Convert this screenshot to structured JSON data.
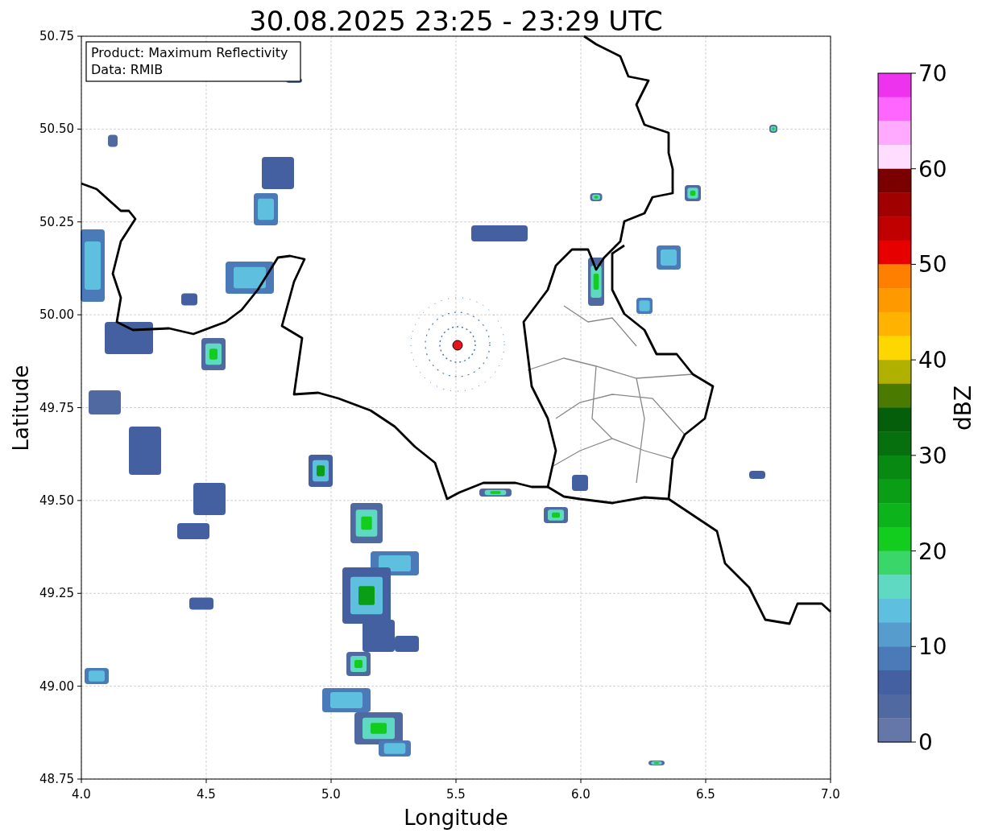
{
  "title": "30.08.2025 23:25 - 23:29 UTC",
  "info_box": {
    "product": "Product: Maximum Reflectivity",
    "source": "Data: RMIB"
  },
  "x_axis": {
    "label": "Longitude",
    "ticks": [
      "4.0",
      "4.5",
      "5.0",
      "5.5",
      "6.0",
      "6.5",
      "7.0"
    ]
  },
  "y_axis": {
    "label": "Latitude",
    "ticks": [
      "50.75",
      "50.50",
      "50.25",
      "50.00",
      "49.75",
      "49.50",
      "49.25",
      "49.00",
      "48.75"
    ]
  },
  "colorbar": {
    "label": "dBZ",
    "ticks": [
      "70",
      "60",
      "50",
      "40",
      "30",
      "20",
      "10",
      "0"
    ],
    "segments": [
      {
        "color": "#ee33ee"
      },
      {
        "color": "#ff66ff"
      },
      {
        "color": "#ffaaff"
      },
      {
        "color": "#ffddff"
      },
      {
        "color": "#7a0000"
      },
      {
        "color": "#a00000"
      },
      {
        "color": "#c00000"
      },
      {
        "color": "#e60000"
      },
      {
        "color": "#ff7f00"
      },
      {
        "color": "#ff9900"
      },
      {
        "color": "#ffb300"
      },
      {
        "color": "#ffd700"
      },
      {
        "color": "#b0b000"
      },
      {
        "color": "#4a7a00"
      },
      {
        "color": "#055e0a"
      },
      {
        "color": "#06700e"
      },
      {
        "color": "#088a12"
      },
      {
        "color": "#0a9e16"
      },
      {
        "color": "#0db31a"
      },
      {
        "color": "#12cc1e"
      },
      {
        "color": "#3ad66a"
      },
      {
        "color": "#5fd9c2"
      },
      {
        "color": "#5fbfde"
      },
      {
        "color": "#569ccc"
      },
      {
        "color": "#4a7ab8"
      },
      {
        "color": "#4560a0"
      },
      {
        "color": "#5069a0"
      },
      {
        "color": "#6577a8"
      }
    ]
  }
}
